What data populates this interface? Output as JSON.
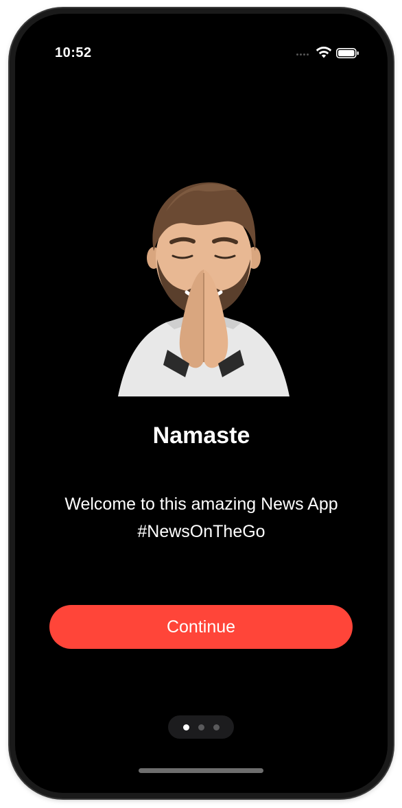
{
  "status_bar": {
    "time": "10:52",
    "icons": [
      "signal-icon",
      "wifi-icon",
      "battery-icon"
    ]
  },
  "onboarding": {
    "illustration": "memoji-namaste",
    "title": "Namaste",
    "subtitle": "Welcome to this amazing News App #NewsOnTheGo",
    "continue_label": "Continue",
    "accent_color": "#ff4539",
    "page_indicator": {
      "total": 3,
      "current": 1
    }
  }
}
